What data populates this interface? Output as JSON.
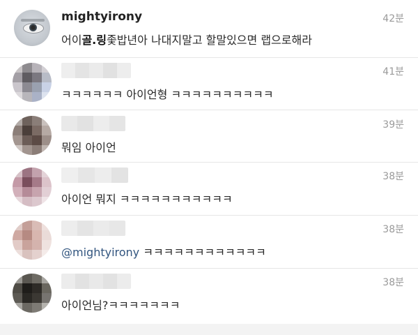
{
  "comments": [
    {
      "username": "mightyirony",
      "time": "42분",
      "text_pre": "어이",
      "text_bold": "골.링",
      "text_post": "좇밥년아 나대지말고 할말있으면 랩으로해라"
    },
    {
      "time": "41분",
      "text": "ㅋㅋㅋㅋㅋㅋ 아이언형 ㅋㅋㅋㅋㅋㅋㅋㅋㅋㅋ"
    },
    {
      "time": "39분",
      "text": "뭐임 아이언"
    },
    {
      "time": "38분",
      "text": "아이언 뭐지 ㅋㅋㅋㅋㅋㅋㅋㅋㅋㅋㅋ"
    },
    {
      "time": "38분",
      "mention": "@mightyirony",
      "text": " ㅋㅋㅋㅋㅋㅋㅋㅋㅋㅋㅋㅋ"
    },
    {
      "time": "38분",
      "text": "아이언님?ㅋㅋㅋㅋㅋㅋㅋ"
    }
  ]
}
